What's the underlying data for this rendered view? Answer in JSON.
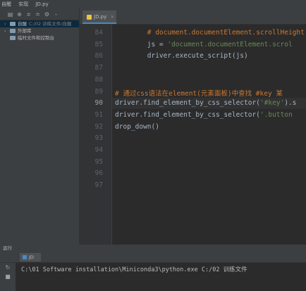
{
  "topbar": {
    "items": [
      "自醒",
      "实现"
    ],
    "file": "JD.py"
  },
  "project": {
    "toolbar_icons": [
      "layout-icon",
      "target-icon",
      "collapse-icon",
      "expand-icon",
      "gear-icon",
      "minimize-icon"
    ],
    "tree": [
      {
        "label": "自醒",
        "path": "C:/02 训练文件/自醒",
        "selected": true,
        "expanded": false
      },
      {
        "label": "外部库",
        "path": "",
        "selected": false,
        "expanded": false
      },
      {
        "label": "临时文件和控制台",
        "path": "",
        "selected": false,
        "expanded": false
      }
    ]
  },
  "editor": {
    "tab_label": "JD.py",
    "current_line": "90",
    "lines": [
      {
        "n": "84",
        "tokens": [
          {
            "t": "        ",
            "c": "id"
          },
          {
            "t": "# document.documentElement.scrollHeight",
            "c": "cm"
          }
        ]
      },
      {
        "n": "85",
        "tokens": [
          {
            "t": "        js = ",
            "c": "id"
          },
          {
            "t": "'document.documentElement.scrol",
            "c": "st"
          }
        ]
      },
      {
        "n": "86",
        "tokens": [
          {
            "t": "        driver.execute_script(js)",
            "c": "id"
          }
        ]
      },
      {
        "n": "87",
        "tokens": []
      },
      {
        "n": "88",
        "tokens": []
      },
      {
        "n": "89",
        "tokens": [
          {
            "t": "# 通过css语法在element(元素面板)中查找 #key 某",
            "c": "cm"
          }
        ]
      },
      {
        "n": "90",
        "tokens": [
          {
            "t": "driver.find_element_by_css_selector(",
            "c": "id"
          },
          {
            "t": "'#key'",
            "c": "st"
          },
          {
            "t": ").s",
            "c": "id"
          }
        ]
      },
      {
        "n": "91",
        "tokens": [
          {
            "t": "driver.find_element_by_css_selector(",
            "c": "id"
          },
          {
            "t": "'.button",
            "c": "st"
          }
        ]
      },
      {
        "n": "92",
        "tokens": [
          {
            "t": "drop_down()",
            "c": "id"
          }
        ]
      },
      {
        "n": "93",
        "tokens": []
      },
      {
        "n": "94",
        "tokens": []
      },
      {
        "n": "95",
        "tokens": []
      },
      {
        "n": "96",
        "tokens": []
      },
      {
        "n": "97",
        "tokens": []
      }
    ]
  },
  "run": {
    "panel_label": "运行",
    "tab_label": "JD",
    "command": "C:\\01 Software installation\\Miniconda3\\python.exe C:/02 训练文件"
  }
}
